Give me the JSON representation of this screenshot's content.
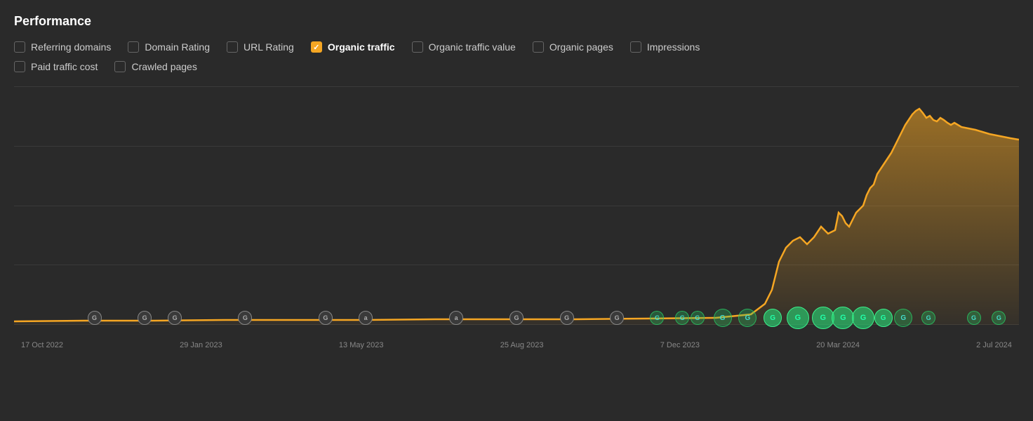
{
  "title": "Performance",
  "checkboxes_row1": [
    {
      "id": "referring-domains",
      "label": "Referring domains",
      "checked": false
    },
    {
      "id": "domain-rating",
      "label": "Domain Rating",
      "checked": false
    },
    {
      "id": "url-rating",
      "label": "URL Rating",
      "checked": false
    },
    {
      "id": "organic-traffic",
      "label": "Organic traffic",
      "checked": true
    },
    {
      "id": "organic-traffic-value",
      "label": "Organic traffic value",
      "checked": false
    },
    {
      "id": "organic-pages",
      "label": "Organic pages",
      "checked": false
    },
    {
      "id": "impressions",
      "label": "Impressions",
      "checked": false
    }
  ],
  "checkboxes_row2": [
    {
      "id": "paid-traffic-cost",
      "label": "Paid traffic cost",
      "checked": false
    },
    {
      "id": "crawled-pages",
      "label": "Crawled pages",
      "checked": false
    }
  ],
  "timeline_labels": [
    "17 Oct 2022",
    "29 Jan 2023",
    "13 May 2023",
    "25 Aug 2023",
    "7 Dec 2023",
    "20 Mar 2024",
    "2 Jul 2024"
  ],
  "chart": {
    "line_color": "#f5a623",
    "fill_color_start": "rgba(245,166,35,0.5)",
    "fill_color_end": "rgba(245,166,35,0.0)"
  },
  "markers": {
    "google_label": "G",
    "bing_label": "a"
  }
}
